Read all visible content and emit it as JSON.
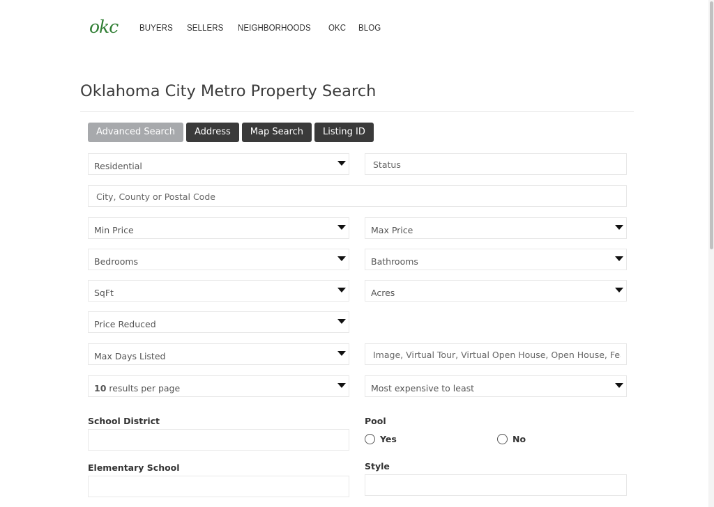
{
  "header": {
    "logo_text": "okc",
    "nav": [
      "BUYERS",
      "SELLERS",
      "NEIGHBORHOODS",
      "OKC",
      "BLOG"
    ]
  },
  "page": {
    "title": "Oklahoma City Metro Property Search"
  },
  "tabs": [
    {
      "label": "Advanced Search",
      "active": true
    },
    {
      "label": "Address",
      "active": false
    },
    {
      "label": "Map Search",
      "active": false
    },
    {
      "label": "Listing ID",
      "active": false
    }
  ],
  "form": {
    "property_type": "Residential",
    "status_placeholder": "Status",
    "location_placeholder": "City, County or Postal Code",
    "min_price": "Min Price",
    "max_price": "Max Price",
    "bedrooms": "Bedrooms",
    "bathrooms": "Bathrooms",
    "sqft": "SqFt",
    "acres": "Acres",
    "price_reduced": "Price Reduced",
    "max_days_listed": "Max Days Listed",
    "features_placeholder": "Image, Virtual Tour, Virtual Open House, Open House, Feat",
    "results_count": "10",
    "results_suffix": " results per page",
    "sort": "Most expensive to least",
    "school_district_label": "School District",
    "pool_label": "Pool",
    "pool_yes": "Yes",
    "pool_no": "No",
    "elementary_label": "Elementary School",
    "style_label": "Style"
  }
}
